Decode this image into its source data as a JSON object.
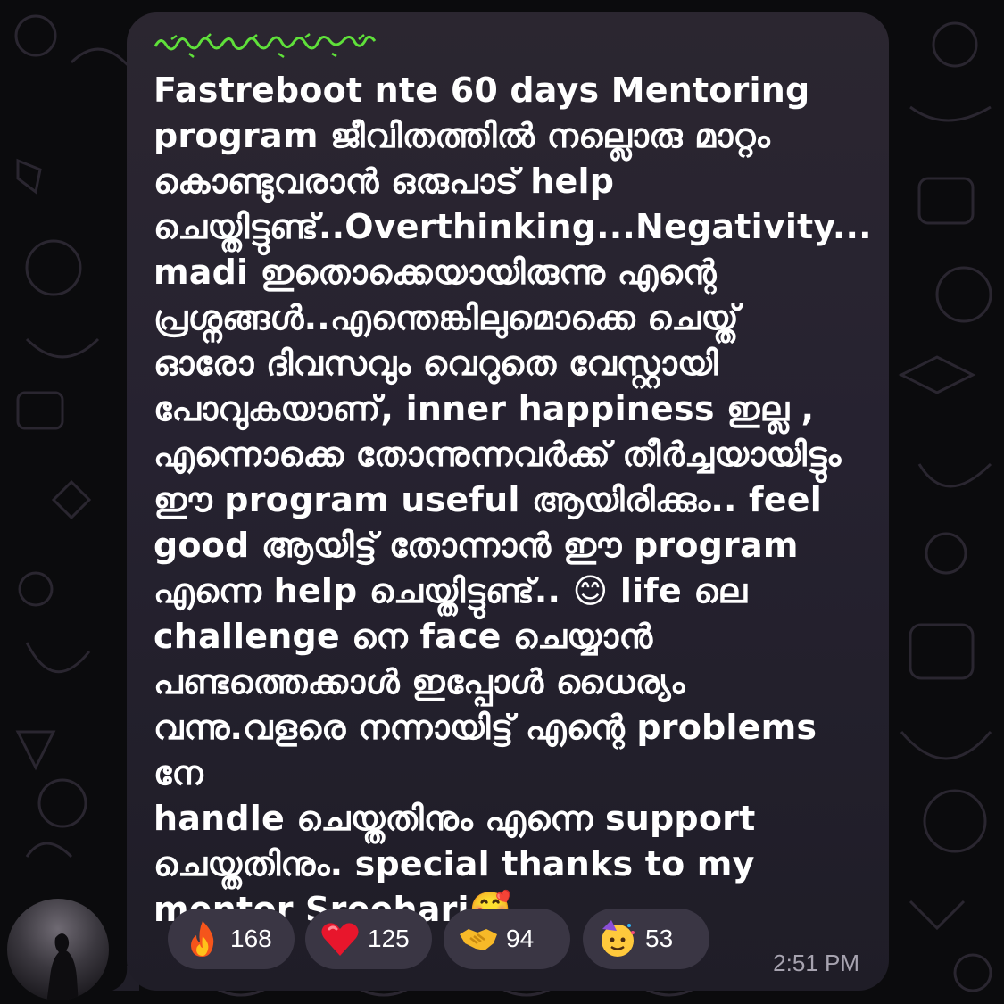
{
  "message": {
    "sender_name": "",
    "text": "Fastreboot nte 60 days Mentoring\nprogram ജീവിതത്തിൽ നല്ലൊരു മാറ്റം\nകൊണ്ടുവരാൻ ഒരുപാട് help\nചെയ്തിട്ടുണ്ട്..Overthinking...Negativity...\nmadi ഇതൊക്കെയായിരുന്നു എന്റെ\nപ്രശ്നങ്ങൾ..എന്തെങ്കിലുമൊക്കെ ചെയ്ത്\nഓരോ ദിവസവും വെറുതെ വേസ്റ്റായി\nപോവുകയാണ്, inner happiness ഇല്ല ,\nഎന്നൊക്കെ തോന്നുന്നവർക്ക് തീർച്ചയായിട്ടും\nഈ program useful ആയിരിക്കും.. feel\ngood ആയിട്ട് തോന്നാൻ ഈ program\nഎന്നെ help ചെയ്തിട്ടുണ്ട്.. 😊 life ലെ\nchallenge നെ face ചെയ്യാൻ\nപണ്ടത്തെക്കാൾ ഇപ്പോൾ ധൈര്യം\nവന്നു.വളരെ നന്നായിട്ട് എന്റെ problems നേ\nhandle ചെയ്തതിനും എന്നെ support\nചെയ്തതിനും. special thanks to my\nmentor Sreehari🥰",
    "time": "2:51 PM"
  },
  "reactions": [
    {
      "icon": "fire-emoji",
      "count": "168"
    },
    {
      "icon": "heart-emoji",
      "count": "125"
    },
    {
      "icon": "handshake-emoji",
      "count": "94"
    },
    {
      "icon": "party-face-emoji",
      "count": "53"
    }
  ],
  "colors": {
    "background": "#0b0b0d",
    "bubble": "#262230",
    "reaction_pill": "#3a3644",
    "sender_name": "#5fe03a",
    "timestamp": "#a7a3b0"
  }
}
